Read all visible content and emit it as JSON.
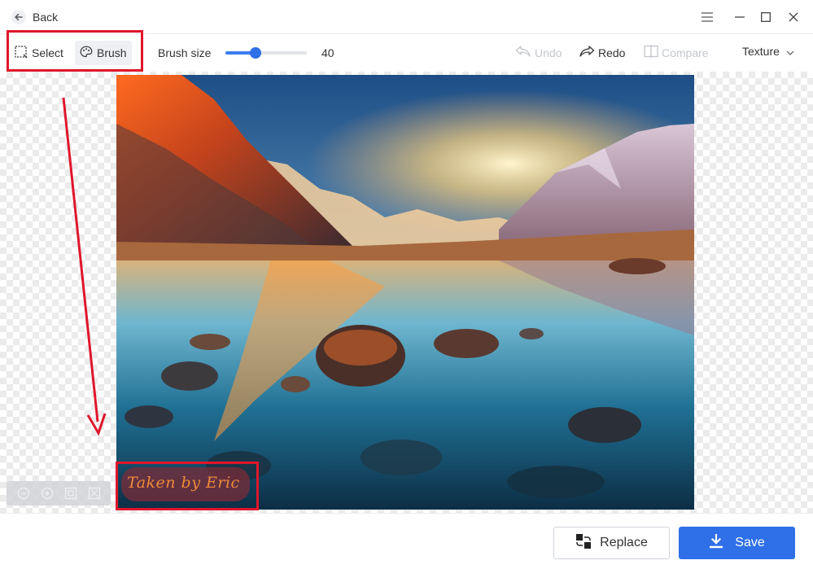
{
  "titlebar": {
    "back_label": "Back",
    "icons": [
      "arrow-left-icon",
      "menu-icon",
      "minimize-icon",
      "maximize-icon",
      "close-icon"
    ]
  },
  "toolbar": {
    "select_label": "Select",
    "brush_label": "Brush",
    "active_tool": "Brush",
    "brush_size_label": "Brush size",
    "brush_size_value": "40",
    "brush_size_fraction": 0.37,
    "undo_label": "Undo",
    "redo_label": "Redo",
    "compare_label": "Compare",
    "texture_label": "Texture"
  },
  "canvas": {
    "watermark_text": "Taken by Eric",
    "zoom_icons": [
      "zoom-out-icon",
      "zoom-in-icon",
      "fit-screen-icon",
      "actual-size-icon"
    ]
  },
  "footer": {
    "replace_label": "Replace",
    "save_label": "Save"
  },
  "colors": {
    "accent": "#2f6fe8",
    "annotation": "#e0162b",
    "disabled": "#c3c6cc"
  }
}
